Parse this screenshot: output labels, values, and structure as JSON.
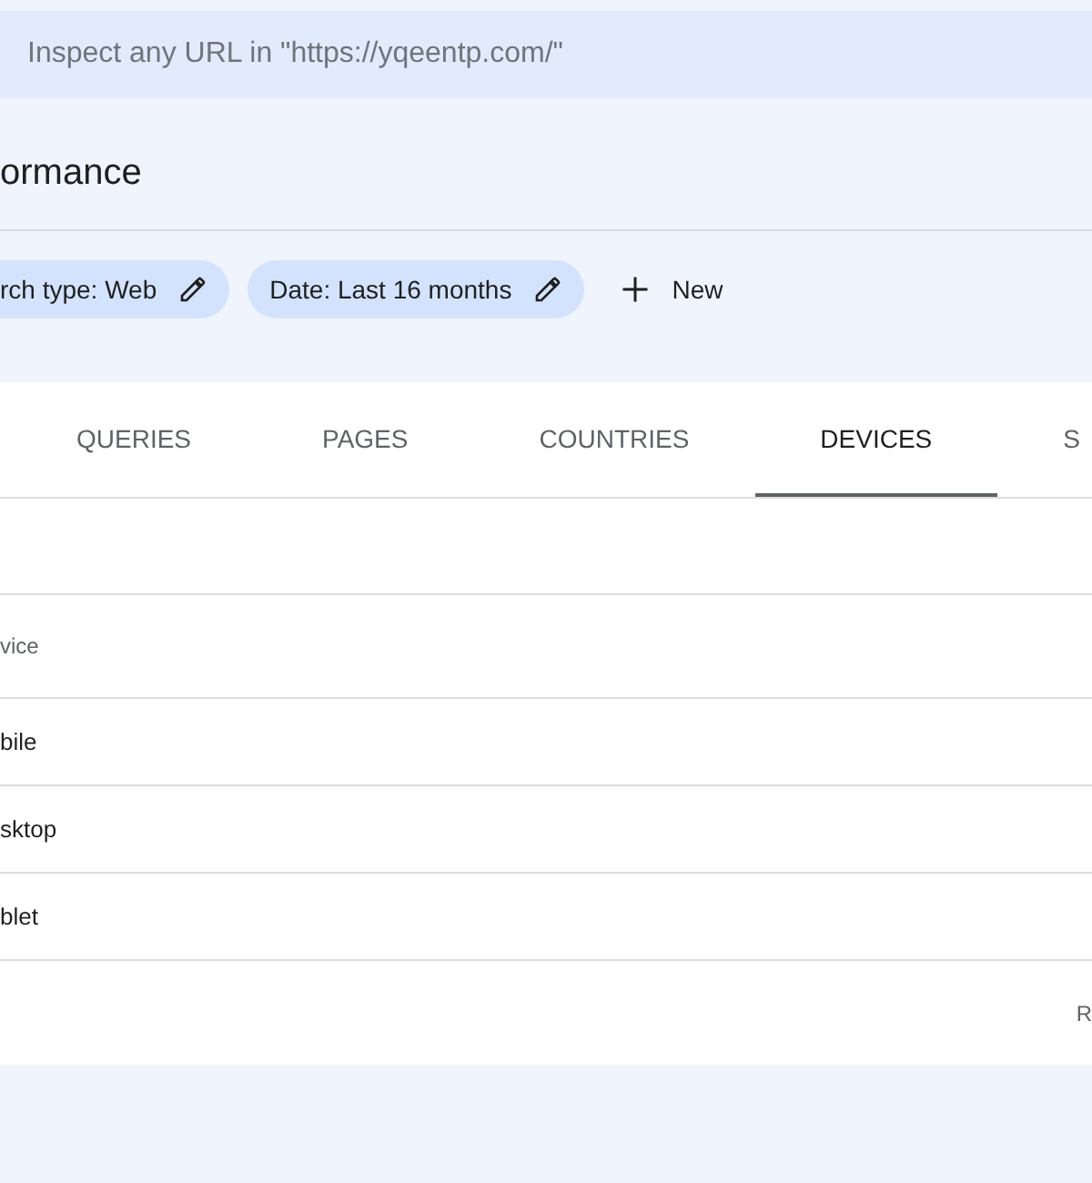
{
  "search": {
    "placeholder": "Inspect any URL in \"https://yqeentp.com/\""
  },
  "title": "ormance",
  "filters": [
    {
      "label": "rch type: Web"
    },
    {
      "label": "Date: Last 16 months"
    }
  ],
  "new_button": "New",
  "tabs": [
    {
      "label": "QUERIES",
      "selected": false
    },
    {
      "label": "PAGES",
      "selected": false
    },
    {
      "label": "COUNTRIES",
      "selected": false
    },
    {
      "label": "DEVICES",
      "selected": true
    },
    {
      "label": "S",
      "selected": false
    }
  ],
  "table": {
    "column": "vice",
    "rows": [
      "bile",
      "sktop",
      "blet"
    ],
    "footer": "R"
  }
}
